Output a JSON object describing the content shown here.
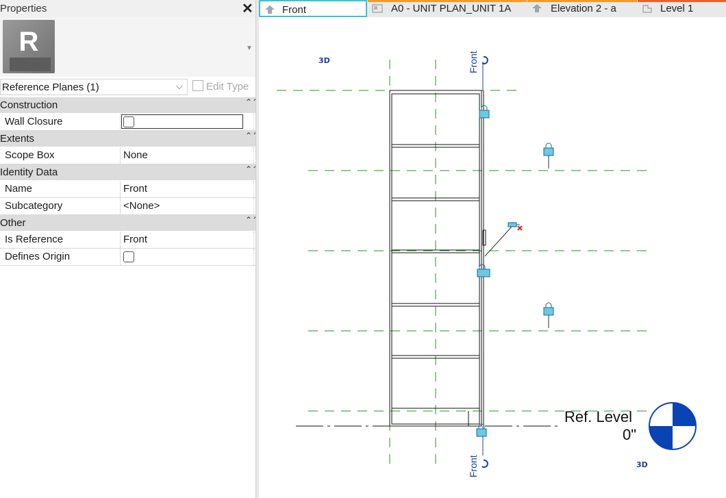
{
  "properties": {
    "title": "Properties",
    "close": "✕",
    "type_selector": "Reference Planes (1)",
    "edit_type": "Edit Type",
    "groups": [
      {
        "label": "Construction",
        "rows": [
          {
            "key": "Wall Closure",
            "checkbox": true,
            "focused": true
          }
        ]
      },
      {
        "label": "Extents",
        "rows": [
          {
            "key": "Scope Box",
            "value": "None"
          }
        ]
      },
      {
        "label": "Identity Data",
        "rows": [
          {
            "key": "Name",
            "value": "Front"
          },
          {
            "key": "Subcategory",
            "value": "<None>"
          }
        ]
      },
      {
        "label": "Other",
        "rows": [
          {
            "key": "Is Reference",
            "value": "Front"
          },
          {
            "key": "Defines Origin",
            "checkbox": true
          }
        ]
      }
    ]
  },
  "tabs": [
    {
      "label": "Front",
      "active": true
    },
    {
      "label": "A0 - UNIT PLAN_UNIT 1A"
    },
    {
      "label": "Elevation 2 - a"
    },
    {
      "label": "Level 1"
    }
  ],
  "canvas": {
    "label_3d": "3D",
    "section_label_top": "Front",
    "section_label_bottom": "Front",
    "ref_level_name": "Ref. Level",
    "ref_level_value": "0\"",
    "colors": {
      "accent": "#3fc1d0",
      "tab_marker": "#f39a2b",
      "dash": "#2e8b2e",
      "annotation": "#1a3fa0",
      "lock": "#58c4e0"
    }
  }
}
